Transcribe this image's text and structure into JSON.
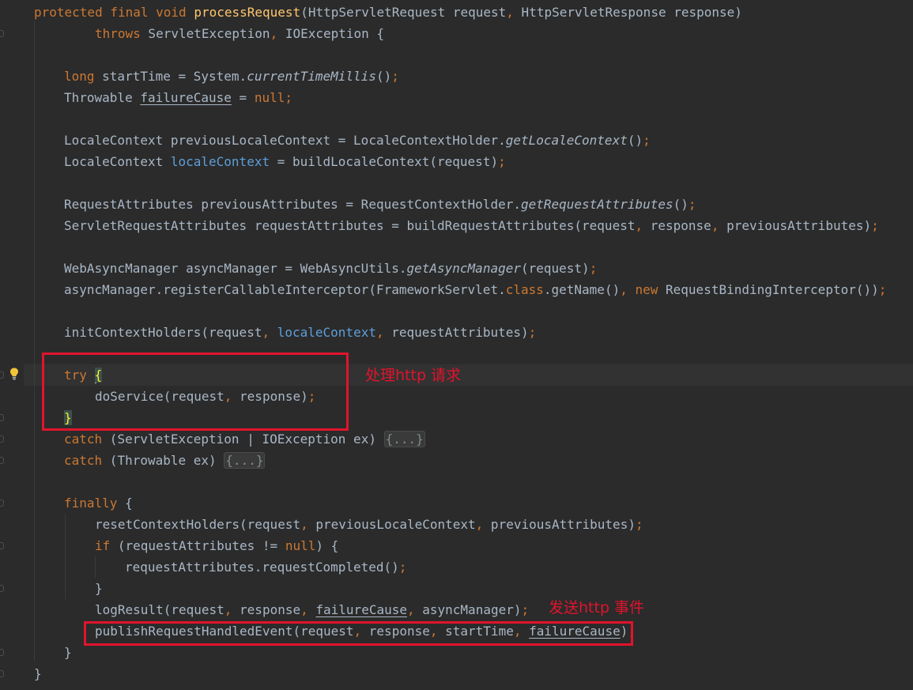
{
  "editor": {
    "lines": [
      "protected final void processRequest(HttpServletRequest request, HttpServletResponse response)",
      "throws ServletException, IOException {",
      "long startTime = System.currentTimeMillis();",
      "Throwable failureCause = null;",
      "LocaleContext previousLocaleContext = LocaleContextHolder.getLocaleContext();",
      "LocaleContext localeContext = buildLocaleContext(request);",
      "RequestAttributes previousAttributes = RequestContextHolder.getRequestAttributes();",
      "ServletRequestAttributes requestAttributes = buildRequestAttributes(request, response, previousAttributes);",
      "WebAsyncManager asyncManager = WebAsyncUtils.getAsyncManager(request);",
      "asyncManager.registerCallableInterceptor(FrameworkServlet.class.getName(), new RequestBindingInterceptor());",
      "initContextHolders(request, localeContext, requestAttributes);",
      "try {",
      "doService(request, response);",
      "}",
      "catch (ServletException | IOException ex) {...}",
      "catch (Throwable ex) {...}",
      "finally {",
      "resetContextHolders(request, previousLocaleContext, previousAttributes);",
      "if (requestAttributes != null) {",
      "requestAttributes.requestCompleted();",
      "}",
      "logResult(request, response, failureCause, asyncManager);",
      "publishRequestHandledEvent(request, response, startTime, failureCause);",
      "}",
      "}"
    ]
  },
  "annotations": {
    "try_block_note": "处理http 请求",
    "event_note": "发送http 事件"
  },
  "colors": {
    "background": "#2b2b2b",
    "keyword": "#cc7832",
    "method_declaration": "#ffc66d",
    "field": "#5d9fda",
    "default_text": "#a9b7c6",
    "annotation_box": "#e0142d"
  },
  "icons": {
    "intention": "lightbulb-icon",
    "fold_markers": "fold-marker-icon"
  }
}
